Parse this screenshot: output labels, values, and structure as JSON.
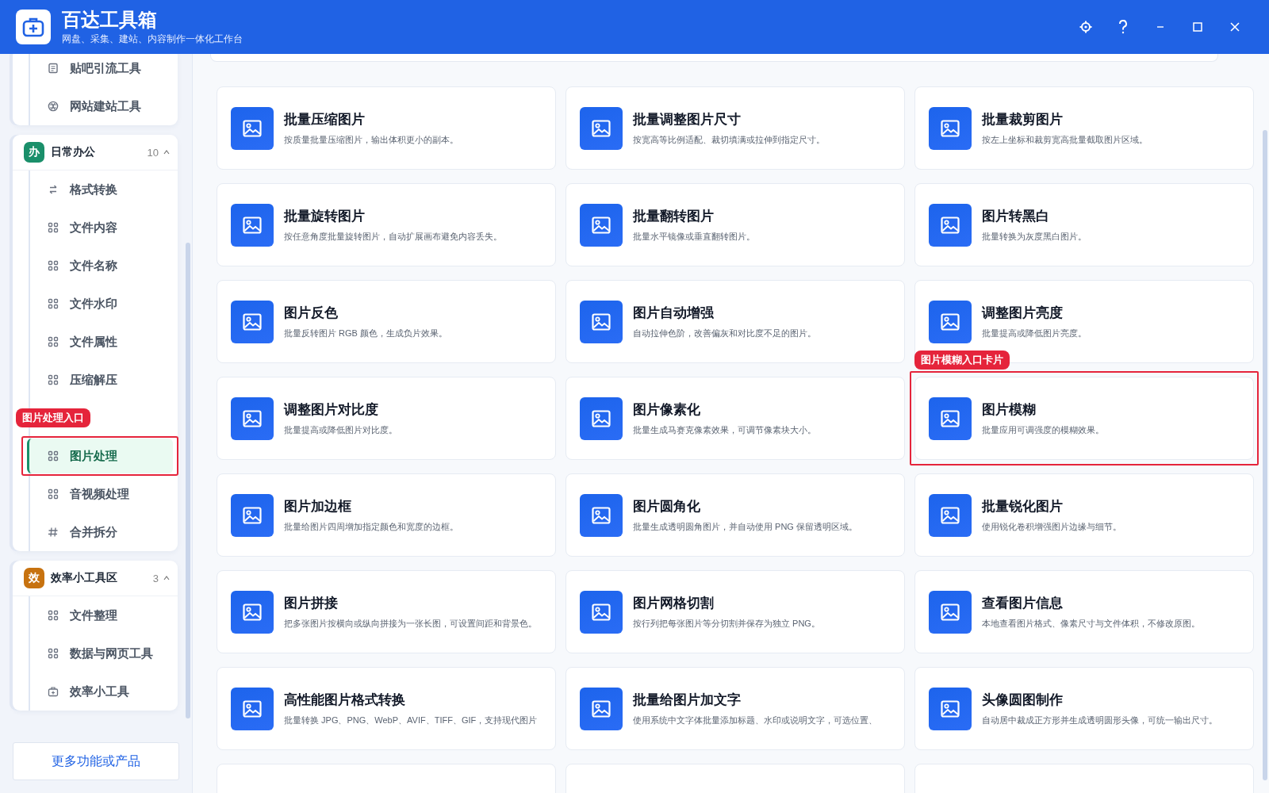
{
  "app": {
    "title": "百达工具箱",
    "subtitle": "网盘、采集、建站、内容制作一体化工作台"
  },
  "sidebar": {
    "groups": [
      {
        "items": [
          {
            "label": "贴吧引流工具",
            "kind": "doc",
            "selected": false
          },
          {
            "label": "网站建站工具",
            "kind": "globe",
            "selected": false
          }
        ]
      },
      {
        "badge": "办",
        "color": "#1a8f6a",
        "title": "日常办公",
        "count": "10",
        "expanded": true,
        "items": [
          {
            "label": "格式转换",
            "kind": "swap",
            "selected": false
          },
          {
            "label": "文件内容",
            "kind": "grid",
            "selected": false
          },
          {
            "label": "文件名称",
            "kind": "grid",
            "selected": false
          },
          {
            "label": "文件水印",
            "kind": "grid",
            "selected": false
          },
          {
            "label": "文件属性",
            "kind": "grid",
            "selected": false
          },
          {
            "label": "压缩解压",
            "kind": "grid",
            "selected": false
          },
          {
            "label": "图片处理",
            "kind": "grid",
            "selected": true,
            "callout": "图片处理入口"
          },
          {
            "label": "音视频处理",
            "kind": "grid",
            "selected": false
          },
          {
            "label": "合并拆分",
            "kind": "hash",
            "selected": false
          }
        ]
      },
      {
        "badge": "效",
        "color": "#c7720f",
        "title": "效率小工具区",
        "count": "3",
        "expanded": true,
        "items": [
          {
            "label": "文件整理",
            "kind": "grid",
            "selected": false
          },
          {
            "label": "数据与网页工具",
            "kind": "grid",
            "selected": false
          },
          {
            "label": "效率小工具",
            "kind": "box",
            "selected": false
          }
        ]
      }
    ],
    "more_button": "更多功能或产品"
  },
  "cards": [
    {
      "title": "批量压缩图片",
      "desc": "按质量批量压缩图片，输出体积更小的副本。"
    },
    {
      "title": "批量调整图片尺寸",
      "desc": "按宽高等比例适配、裁切填满或拉伸到指定尺寸。"
    },
    {
      "title": "批量裁剪图片",
      "desc": "按左上坐标和裁剪宽高批量截取图片区域。"
    },
    {
      "title": "批量旋转图片",
      "desc": "按任意角度批量旋转图片，自动扩展画布避免内容丢失。"
    },
    {
      "title": "批量翻转图片",
      "desc": "批量水平镜像或垂直翻转图片。"
    },
    {
      "title": "图片转黑白",
      "desc": "批量转换为灰度黑白图片。"
    },
    {
      "title": "图片反色",
      "desc": "批量反转图片 RGB 颜色，生成负片效果。"
    },
    {
      "title": "图片自动增强",
      "desc": "自动拉伸色阶，改善偏灰和对比度不足的图片。"
    },
    {
      "title": "调整图片亮度",
      "desc": "批量提高或降低图片亮度。"
    },
    {
      "title": "调整图片对比度",
      "desc": "批量提高或降低图片对比度。"
    },
    {
      "title": "图片像素化",
      "desc": "批量生成马赛克像素效果，可调节像素块大小。"
    },
    {
      "title": "图片模糊",
      "desc": "批量应用可调强度的模糊效果。",
      "callout": "图片模糊入口卡片"
    },
    {
      "title": "图片加边框",
      "desc": "批量给图片四周增加指定颜色和宽度的边框。"
    },
    {
      "title": "图片圆角化",
      "desc": "批量生成透明圆角图片，并自动使用 PNG 保留透明区域。"
    },
    {
      "title": "批量锐化图片",
      "desc": "使用锐化卷积增强图片边缘与细节。"
    },
    {
      "title": "图片拼接",
      "desc": "把多张图片按横向或纵向拼接为一张长图，可设置间距和背景色。"
    },
    {
      "title": "图片网格切割",
      "desc": "按行列把每张图片等分切割并保存为独立 PNG。"
    },
    {
      "title": "查看图片信息",
      "desc": "本地查看图片格式、像素尺寸与文件体积，不修改原图。"
    },
    {
      "title": "高性能图片格式转换",
      "desc": "批量转换 JPG、PNG、WebP、AVIF、TIFF、GIF，支持现代图片"
    },
    {
      "title": "批量给图片加文字",
      "desc": "使用系统中文字体批量添加标题、水印或说明文字，可选位置、"
    },
    {
      "title": "头像圆图制作",
      "desc": "自动居中裁成正方形并生成透明圆形头像，可统一输出尺寸。"
    }
  ]
}
